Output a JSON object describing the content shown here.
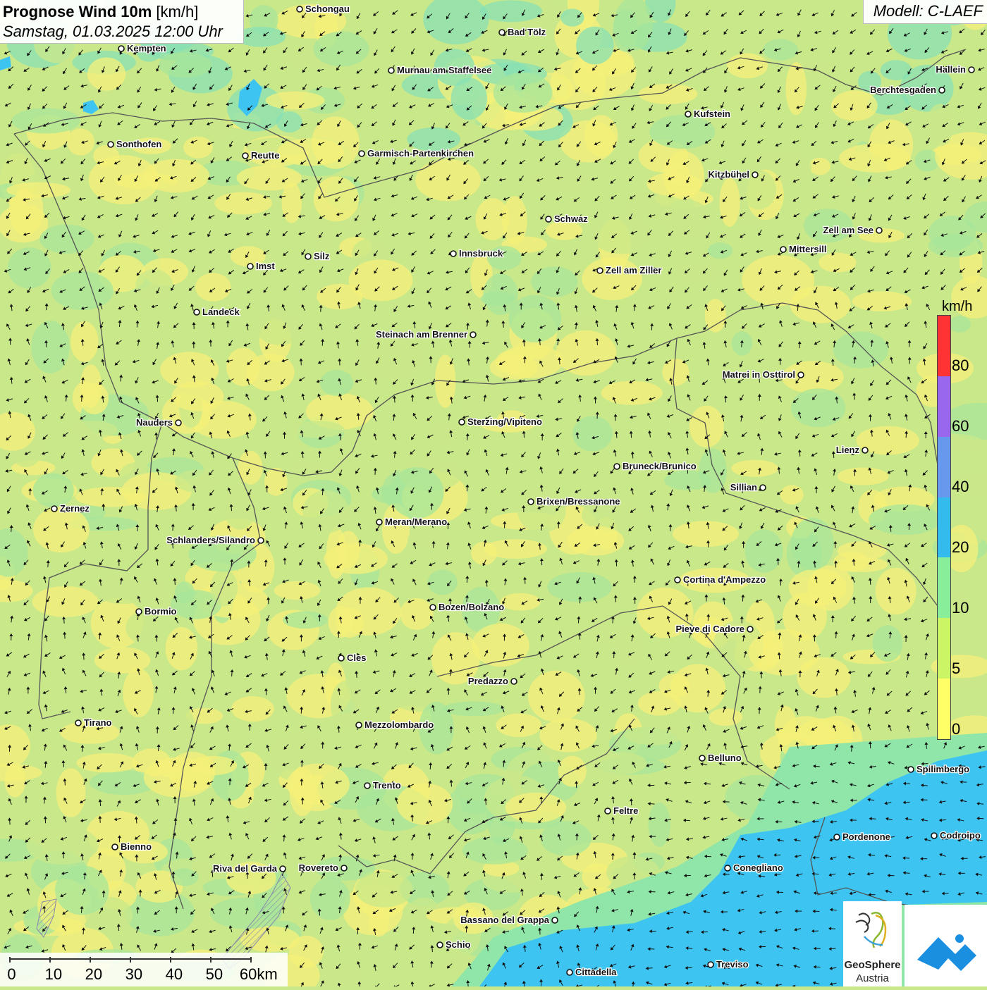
{
  "header": {
    "title_bold": "Prognose Wind 10m",
    "title_unit": "[km/h]",
    "datetime": "Samstag, 01.03.2025 12:00 Uhr",
    "model": "Modell: C-LAEF"
  },
  "legend": {
    "unit": "km/h",
    "labels": [
      "80",
      "60",
      "40",
      "20",
      "10",
      "5",
      "0"
    ],
    "colors": [
      "#ff3333",
      "#9966ee",
      "#6699ee",
      "#33bbee",
      "#88ee99",
      "#ccf566",
      "#ffff66"
    ]
  },
  "scale_bar": {
    "labels": [
      "0",
      "10",
      "20",
      "30",
      "40",
      "50",
      "60km"
    ]
  },
  "logos": {
    "geosphere_name": "GeoSphere",
    "geosphere_sub": "Austria",
    "mountain_icon": "mountain-logo-icon",
    "spiral_icon": "geosphere-spiral-icon"
  },
  "map_colors": {
    "yellow": "#f5f07a",
    "light_green": "#c9e88a",
    "green": "#a8e69a",
    "teal": "#88e0b4",
    "blue": "#3ec4f0",
    "border": "#555555"
  },
  "cities": [
    {
      "name": "Schongau"
    },
    {
      "name": "Bad Tölz"
    },
    {
      "name": "Kempten"
    },
    {
      "name": "Murnau am Staffelsee"
    },
    {
      "name": "Hallein"
    },
    {
      "name": "Berchtesgaden"
    },
    {
      "name": "Kufstein"
    },
    {
      "name": "Sonthofen"
    },
    {
      "name": "Reutte"
    },
    {
      "name": "Garmisch-Partenkirchen"
    },
    {
      "name": "Kitzbühel"
    },
    {
      "name": "Schwaz"
    },
    {
      "name": "Zell am See"
    },
    {
      "name": "Mittersill"
    },
    {
      "name": "Innsbruck"
    },
    {
      "name": "Silz"
    },
    {
      "name": "Imst"
    },
    {
      "name": "Zell am Ziller"
    },
    {
      "name": "Landeck"
    },
    {
      "name": "Steinach am Brenner"
    },
    {
      "name": "Matrei in Osttirol"
    },
    {
      "name": "Nauders"
    },
    {
      "name": "Sterzing/Vipiteno"
    },
    {
      "name": "Lienz"
    },
    {
      "name": "Bruneck/Brunico"
    },
    {
      "name": "Sillian"
    },
    {
      "name": "Zernez"
    },
    {
      "name": "Brixen/Bressanone"
    },
    {
      "name": "Meran/Merano"
    },
    {
      "name": "Schlanders/Silandro"
    },
    {
      "name": "Cortina d'Ampezzo"
    },
    {
      "name": "Bozen/Bolzano"
    },
    {
      "name": "Bormio"
    },
    {
      "name": "Pieve di Cadore"
    },
    {
      "name": "Cles"
    },
    {
      "name": "Predazzo"
    },
    {
      "name": "Tirano"
    },
    {
      "name": "Mezzolombardo"
    },
    {
      "name": "Belluno"
    },
    {
      "name": "Spilimbergo"
    },
    {
      "name": "Trento"
    },
    {
      "name": "Feltre"
    },
    {
      "name": "Pordenone"
    },
    {
      "name": "Codroipo"
    },
    {
      "name": "Bienno"
    },
    {
      "name": "Riva del Garda"
    },
    {
      "name": "Rovereto"
    },
    {
      "name": "Conegliano"
    },
    {
      "name": "Bassano del Grappa"
    },
    {
      "name": "Schio"
    },
    {
      "name": "Treviso"
    },
    {
      "name": "Cittadella"
    }
  ]
}
